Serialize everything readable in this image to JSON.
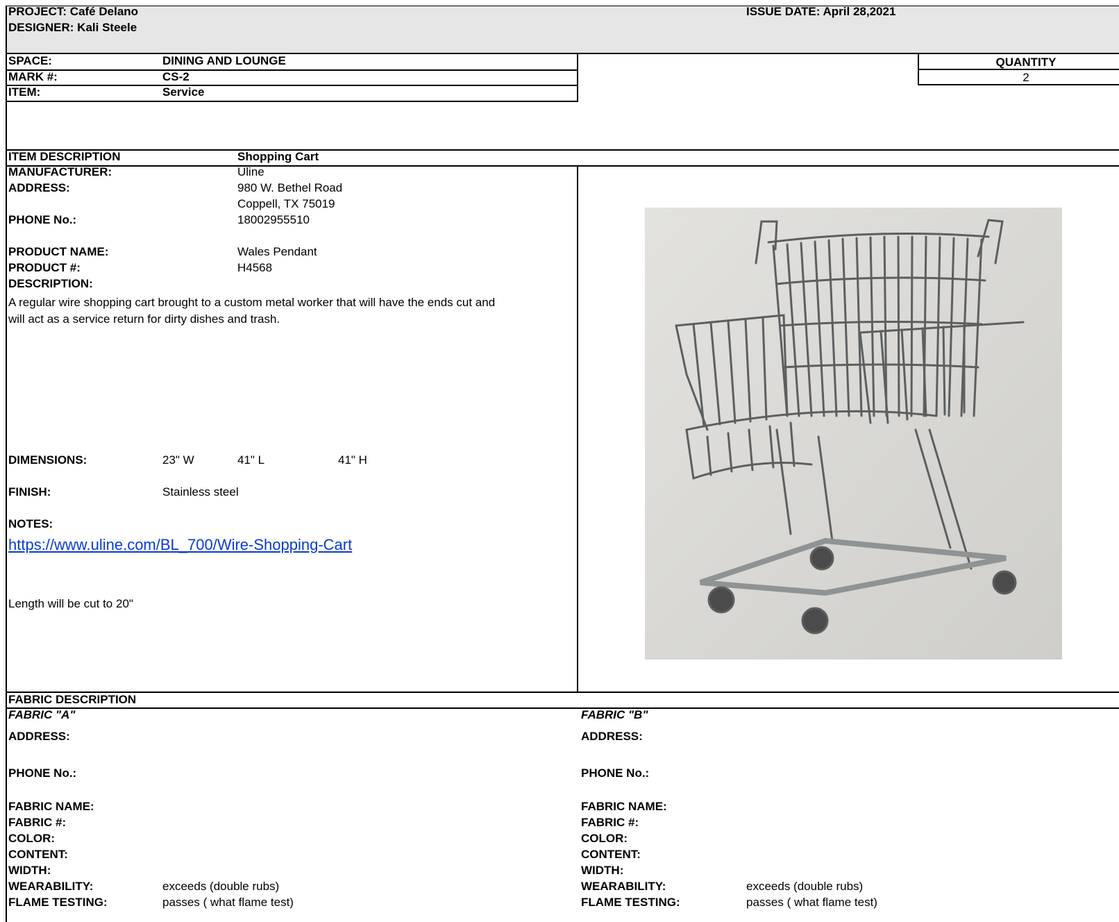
{
  "header": {
    "project": "PROJECT: Café Delano",
    "designer": "DESIGNER: Kali Steele",
    "issue_date": "ISSUE DATE: April 28,2021"
  },
  "info": {
    "space_label": "SPACE:",
    "space_value": "DINING AND LOUNGE",
    "mark_label": "MARK #:",
    "mark_value": "CS-2",
    "item_label": "ITEM:",
    "item_value": "Service",
    "quantity_label": "QUANTITY",
    "quantity_value": "2"
  },
  "item": {
    "section_label": "ITEM DESCRIPTION",
    "section_value": "Shopping Cart",
    "manufacturer_label": "MANUFACTURER:",
    "manufacturer_value": "Uline",
    "address_label": "ADDRESS:",
    "address_line1": "980 W. Bethel Road",
    "address_line2": "Coppell, TX 75019",
    "phone_label": "PHONE No.:",
    "phone_value": "18002955510",
    "product_name_label": "PRODUCT NAME:",
    "product_name_value": "Wales Pendant",
    "product_num_label": "PRODUCT #:",
    "product_num_value": "H4568",
    "description_label": "DESCRIPTION:",
    "description_line1": "A regular wire shopping cart brought to a custom metal worker that will have the ends cut and",
    "description_line2": "will act as a service return for dirty dishes and trash.",
    "dimensions_label": "DIMENSIONS:",
    "dim_w": "23\" W",
    "dim_l": "41\" L",
    "dim_h": "41\" H",
    "finish_label": "FINISH:",
    "finish_value": "Stainless steel",
    "notes_label": "NOTES:",
    "notes_link": "https://www.uline.com/BL_700/Wire-Shopping-Cart",
    "notes_text": "Length will be cut to 20\""
  },
  "fabric": {
    "section_label": "FABRIC DESCRIPTION",
    "a": {
      "title": "FABRIC \"A\"",
      "address_label": "ADDRESS:",
      "phone_label": "PHONE No.:",
      "name_label": "FABRIC NAME:",
      "num_label": "FABRIC #:",
      "color_label": "COLOR:",
      "content_label": "CONTENT:",
      "width_label": "WIDTH:",
      "wear_label": "WEARABILITY:",
      "wear_value": "exceeds (double rubs)",
      "flame_label": "FLAME TESTING:",
      "flame_value": "passes ( what flame test)"
    },
    "b": {
      "title": "FABRIC \"B\"",
      "address_label": "ADDRESS:",
      "phone_label": "PHONE No.:",
      "name_label": "FABRIC NAME:",
      "num_label": "FABRIC #:",
      "color_label": "COLOR:",
      "content_label": "CONTENT:",
      "width_label": "WIDTH:",
      "wear_label": "WEARABILITY:",
      "wear_value": "exceeds (double rubs)",
      "flame_label": "FLAME TESTING:",
      "flame_value": "passes ( what flame test)"
    }
  },
  "image": {
    "subject": "shopping-cart-photo"
  }
}
